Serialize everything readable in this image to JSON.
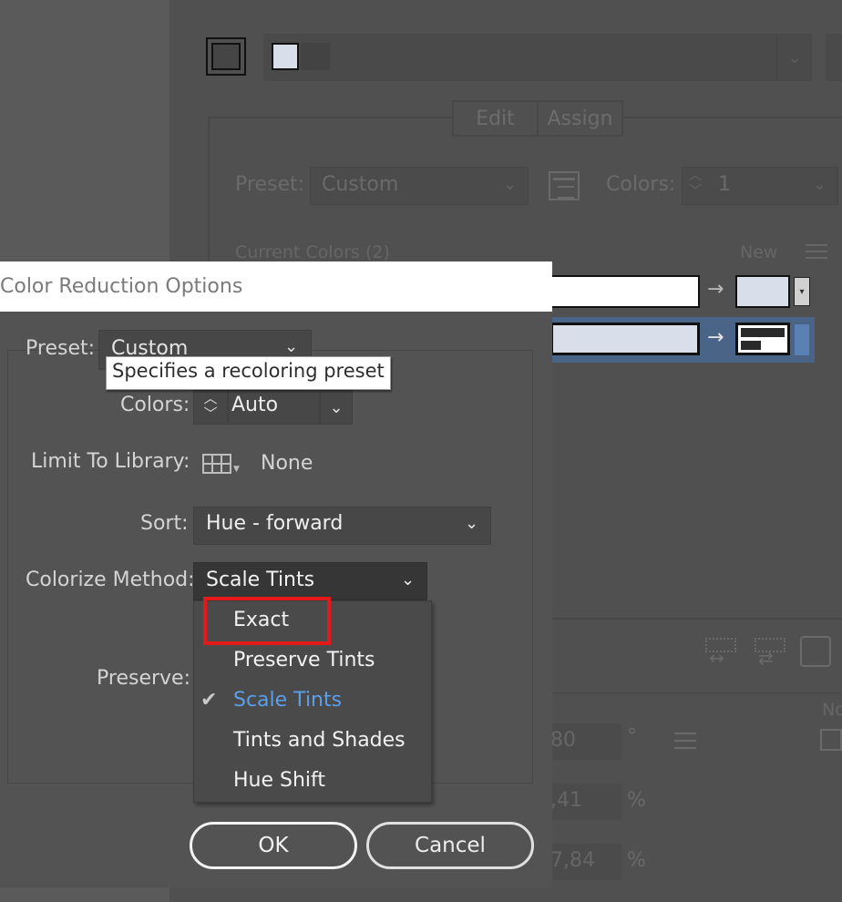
{
  "background_panel": {
    "tabs": [
      "Edit",
      "Assign"
    ],
    "preset_label": "Preset:",
    "preset_value": "Custom",
    "colors_label": "Colors:",
    "colors_value": "1",
    "current_colors_label": "Current Colors (2)",
    "new_label": "New",
    "field_values": [
      "80",
      ",41",
      "7,84"
    ],
    "field_units": [
      "°",
      "%",
      "%"
    ],
    "right_edge_text": "No",
    "swatch_colors": {
      "light_blue": "#d8deea",
      "white": "#ffffff",
      "selected_row": "#4a6488"
    }
  },
  "dialog": {
    "title": "Color Reduction Options",
    "preset": {
      "label": "Preset:",
      "value": "Custom"
    },
    "tooltip": "Specifies a recoloring preset",
    "colors": {
      "label": "Colors:",
      "value": "Auto"
    },
    "limit_to_library": {
      "label": "Limit To Library:",
      "value": "None"
    },
    "sort": {
      "label": "Sort:",
      "value": "Hue - forward"
    },
    "colorize_method": {
      "label": "Colorize Method:",
      "value": "Scale Tints",
      "options": [
        "Exact",
        "Preserve Tints",
        "Scale Tints",
        "Tints and Shades",
        "Hue Shift"
      ],
      "selected_index": 2,
      "highlighted_option": "Exact"
    },
    "preserve": {
      "label": "Preserve:"
    },
    "ok_label": "OK",
    "cancel_label": "Cancel",
    "colors_theme": {
      "selected_option": "#5b9eea",
      "highlight_border": "#e41a1a"
    }
  }
}
